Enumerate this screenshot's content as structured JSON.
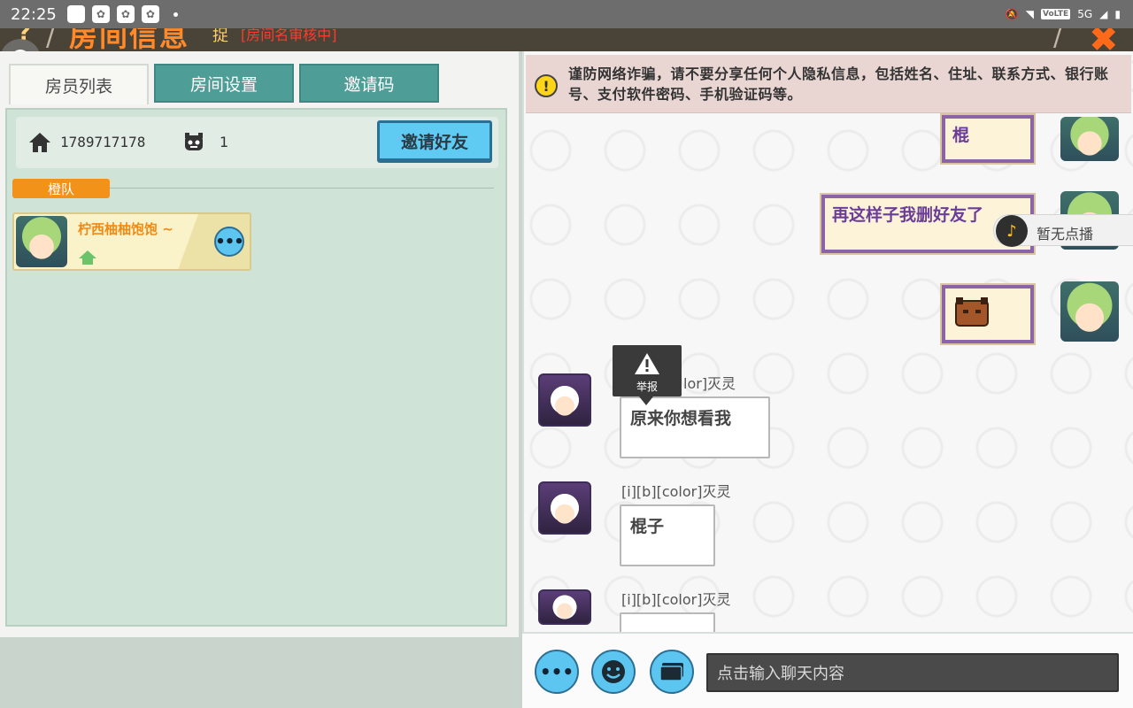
{
  "status_bar": {
    "time": "22:25",
    "network": "5G",
    "volte": "VoLTE"
  },
  "header": {
    "title": "房间信息",
    "subtitle": "捉",
    "pending": "[房间名审核中]",
    "help": "?"
  },
  "tabs": [
    {
      "label": "房员列表",
      "active": true
    },
    {
      "label": "房间设置",
      "active": false
    },
    {
      "label": "邀请码",
      "active": false
    }
  ],
  "room_info": {
    "room_id": "1789717178",
    "member_count": "1",
    "invite_label": "邀请好友"
  },
  "team": {
    "name": "橙队"
  },
  "members": [
    {
      "name": "柠西柚柚饱饱 ~"
    }
  ],
  "warning": {
    "text": "谨防网络诈骗，请不要分享任何个人隐私信息，包括姓名、住址、联系方式、银行账号、支付软件密码、手机验证码等。"
  },
  "chat": {
    "messages": [
      {
        "side": "right",
        "text": "棍"
      },
      {
        "side": "right",
        "text": "再这样子我删好友了"
      },
      {
        "side": "right",
        "text": ""
      },
      {
        "side": "left",
        "sender": "lor]灭灵",
        "text": "原来你想看我"
      },
      {
        "side": "left",
        "sender": "[i][b][color]灭灵",
        "text": "棍子"
      },
      {
        "side": "left",
        "sender": "[i][b][color]灭灵",
        "text": ""
      }
    ],
    "report_label": "举报",
    "music_label": "暂无点播",
    "input_placeholder": "点击输入聊天内容"
  },
  "colors": {
    "accent_blue": "#5cc6f0",
    "orange": "#f29218",
    "tab_teal": "#4f9d97",
    "bubble_purple": "#8b63a7"
  }
}
